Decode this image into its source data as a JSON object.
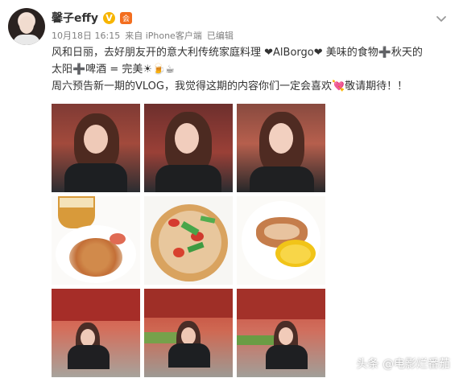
{
  "post": {
    "username": "馨子effy",
    "verified_badge": "V",
    "member_badge": "会",
    "timestamp": "10月18日 16:15",
    "source": "来自 iPhone客户端",
    "edited": "已编辑",
    "content": [
      "风和日丽，去好朋友开的意大利传统家庭料理 ❤AlBorgo❤ 美味的食物➕秋天的",
      "太阳➕啤酒 = 完美☀🍺☕",
      "周六预告新一期的VLOG，我觉得这期的内容你们一定会喜欢💘敬请期待！！"
    ]
  },
  "watermark": {
    "text": "头条 @电影烂番茄"
  },
  "colors": {
    "username": "#333333",
    "meta": "#808080",
    "verify": "#f7b500",
    "member": "#f36e1f"
  },
  "icons": {
    "avatar": "avatar",
    "chevron": "chevron-down-icon",
    "verify": "verified-v-icon",
    "member": "member-badge-icon"
  }
}
